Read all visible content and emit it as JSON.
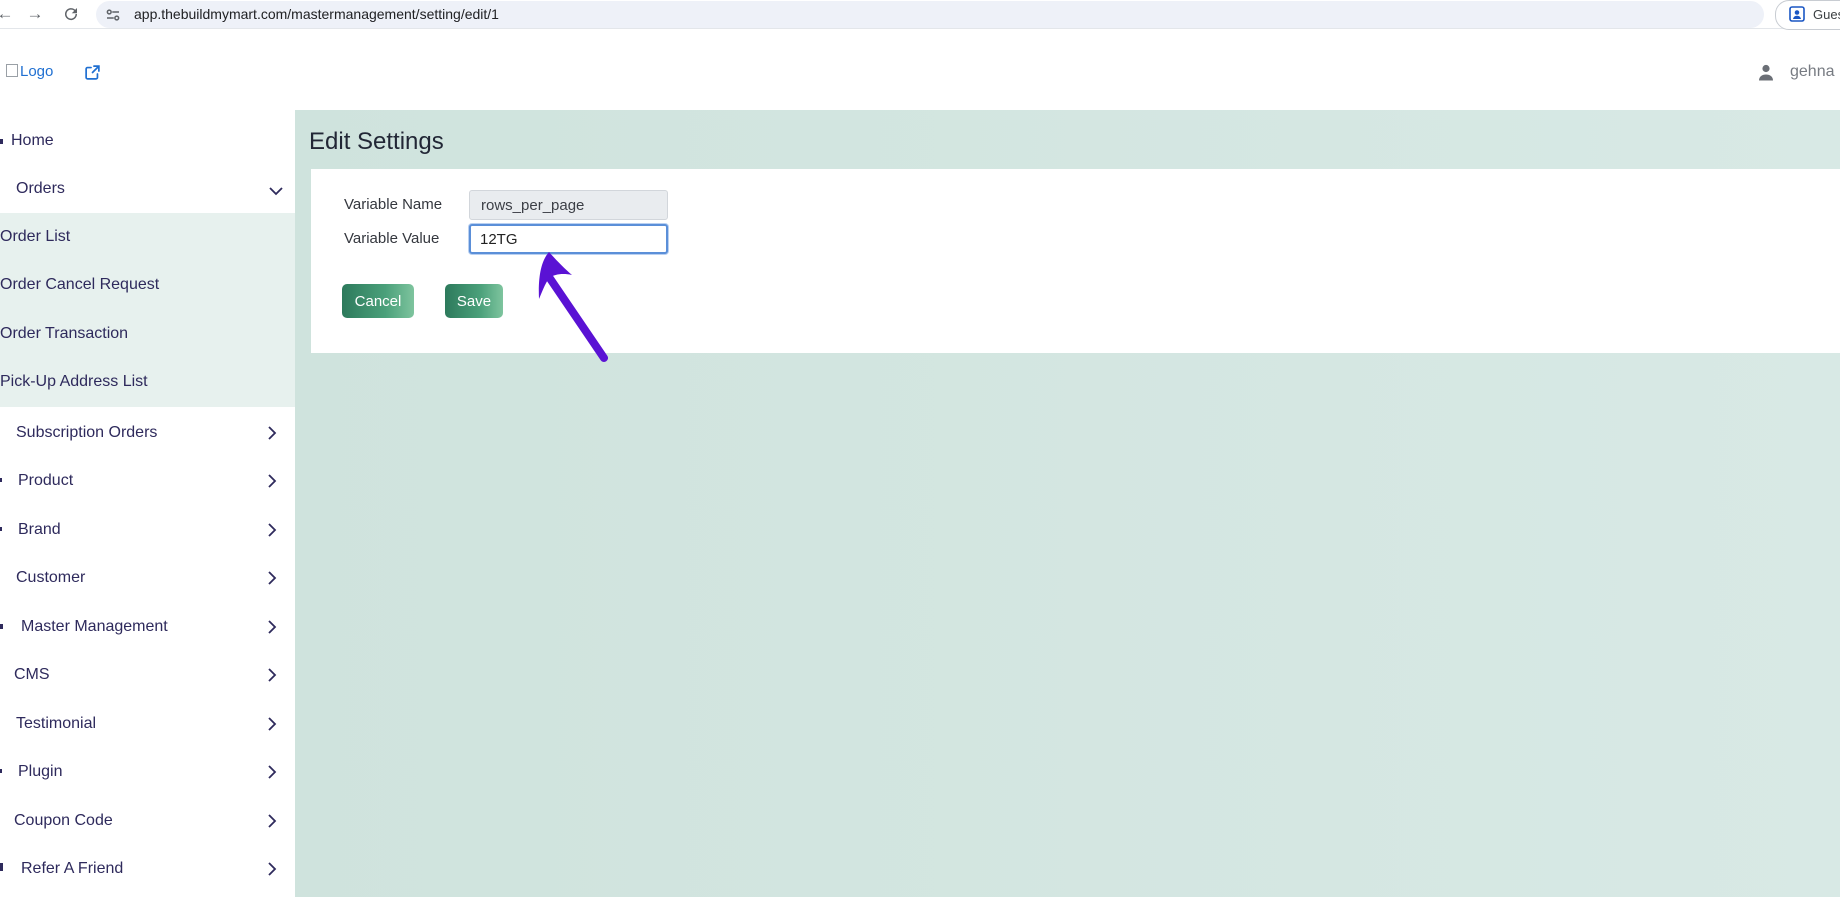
{
  "browser": {
    "url": "app.thebuildmymart.com/mastermanagement/setting/edit/1",
    "profile_label": "Guest"
  },
  "header": {
    "logo_alt": "Logo",
    "user_name": "gehna"
  },
  "sidebar": {
    "items": [
      {
        "label": "Home"
      },
      {
        "label": "Orders"
      },
      {
        "label": "Subscription Orders"
      },
      {
        "label": "Product"
      },
      {
        "label": "Brand"
      },
      {
        "label": "Customer"
      },
      {
        "label": "Master Management"
      },
      {
        "label": "CMS"
      },
      {
        "label": "Testimonial"
      },
      {
        "label": "Plugin"
      },
      {
        "label": "Coupon Code"
      },
      {
        "label": "Refer A Friend"
      }
    ],
    "orders_submenu": [
      {
        "label": "Order List"
      },
      {
        "label": "Order Cancel Request"
      },
      {
        "label": "Order Transaction"
      },
      {
        "label": "Pick-Up Address List"
      }
    ]
  },
  "main": {
    "title": "Edit Settings",
    "form": {
      "variable_name_label": "Variable Name",
      "variable_name_value": "rows_per_page",
      "variable_value_label": "Variable Value",
      "variable_value_value": "12TG"
    },
    "buttons": {
      "cancel": "Cancel",
      "save": "Save"
    }
  },
  "colors": {
    "accent_green": "#2d7a5c",
    "submenu_bg": "#e7f1ee",
    "main_bg": "#cfe3dd",
    "annotation_arrow": "#5a12d4"
  },
  "icons": [
    "back-icon",
    "forward-icon",
    "reload-icon",
    "site-info-icon",
    "profile-icon",
    "external-link-icon",
    "user-icon",
    "chevron-down-icon",
    "chevron-right-icon",
    "annotation-arrow"
  ]
}
